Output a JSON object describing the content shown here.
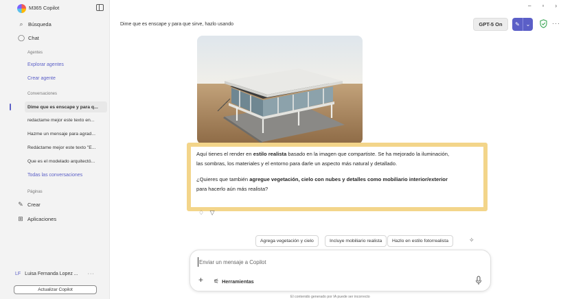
{
  "sidebar": {
    "app_name": "M365 Copilot",
    "search_label": "Búsqueda",
    "chat_label": "Chat",
    "agents_section": "Agentes",
    "explore_agents": "Explorar agentes",
    "create_agent": "Crear agente",
    "conversations_section": "Conversaciones",
    "conversations": [
      "Dime que es enscape y para q...",
      "redactame mejor este texto en...",
      "Hazme un mensaje para agrad...",
      "Redáctame mejor este texto \"E...",
      "Que es el modelado arquitectó..."
    ],
    "all_conversations": "Todas las conversaciones",
    "pages_section": "Páginas",
    "create_label": "Crear",
    "apps_label": "Aplicaciones",
    "user_initials": "LF",
    "user_name": "Luisa Fernanda Lopez ...",
    "update_button": "Actualizar Copilot"
  },
  "header": {
    "conversation_title": "Dime que es enscape y para que sirve, hazlo usando",
    "model_button": "GPT-5 On"
  },
  "message": {
    "p1_a": "Aquí tienes el render en ",
    "p1_bold": "estilo realista",
    "p1_b": " basado en la imagen que compartiste. Se ha mejorado la iluminación,",
    "p1_line2": "las sombras, los materiales y el entorno para darle un aspecto más natural y detallado.",
    "p2_a": "¿Quieres que también ",
    "p2_bold": "agregue vegetación, cielo con nubes y detalles como mobiliario interior/exterior",
    "p2_line2": "para hacerlo aún más realista?"
  },
  "suggestions": [
    "Agrega vegetación y cielo",
    "Incluye mobiliario realista",
    "Hazlo en estilo fotorrealista"
  ],
  "composer": {
    "placeholder": "Enviar un mensaje a Copilot",
    "tools_label": "Herramientas"
  },
  "footer": {
    "disclaimer": "El contenido generado por IA puede ser incorrecto"
  },
  "colors": {
    "accent": "#5b5fc7",
    "highlight_border": "#f3d58a"
  },
  "icons": [
    "search-icon",
    "chat-icon",
    "create-icon",
    "apps-icon",
    "edit-icon",
    "chevron-down-icon",
    "shield-icon",
    "more-icon",
    "plus-icon",
    "tools-icon",
    "mic-icon",
    "thumbs-up-icon",
    "thumbs-down-icon"
  ]
}
